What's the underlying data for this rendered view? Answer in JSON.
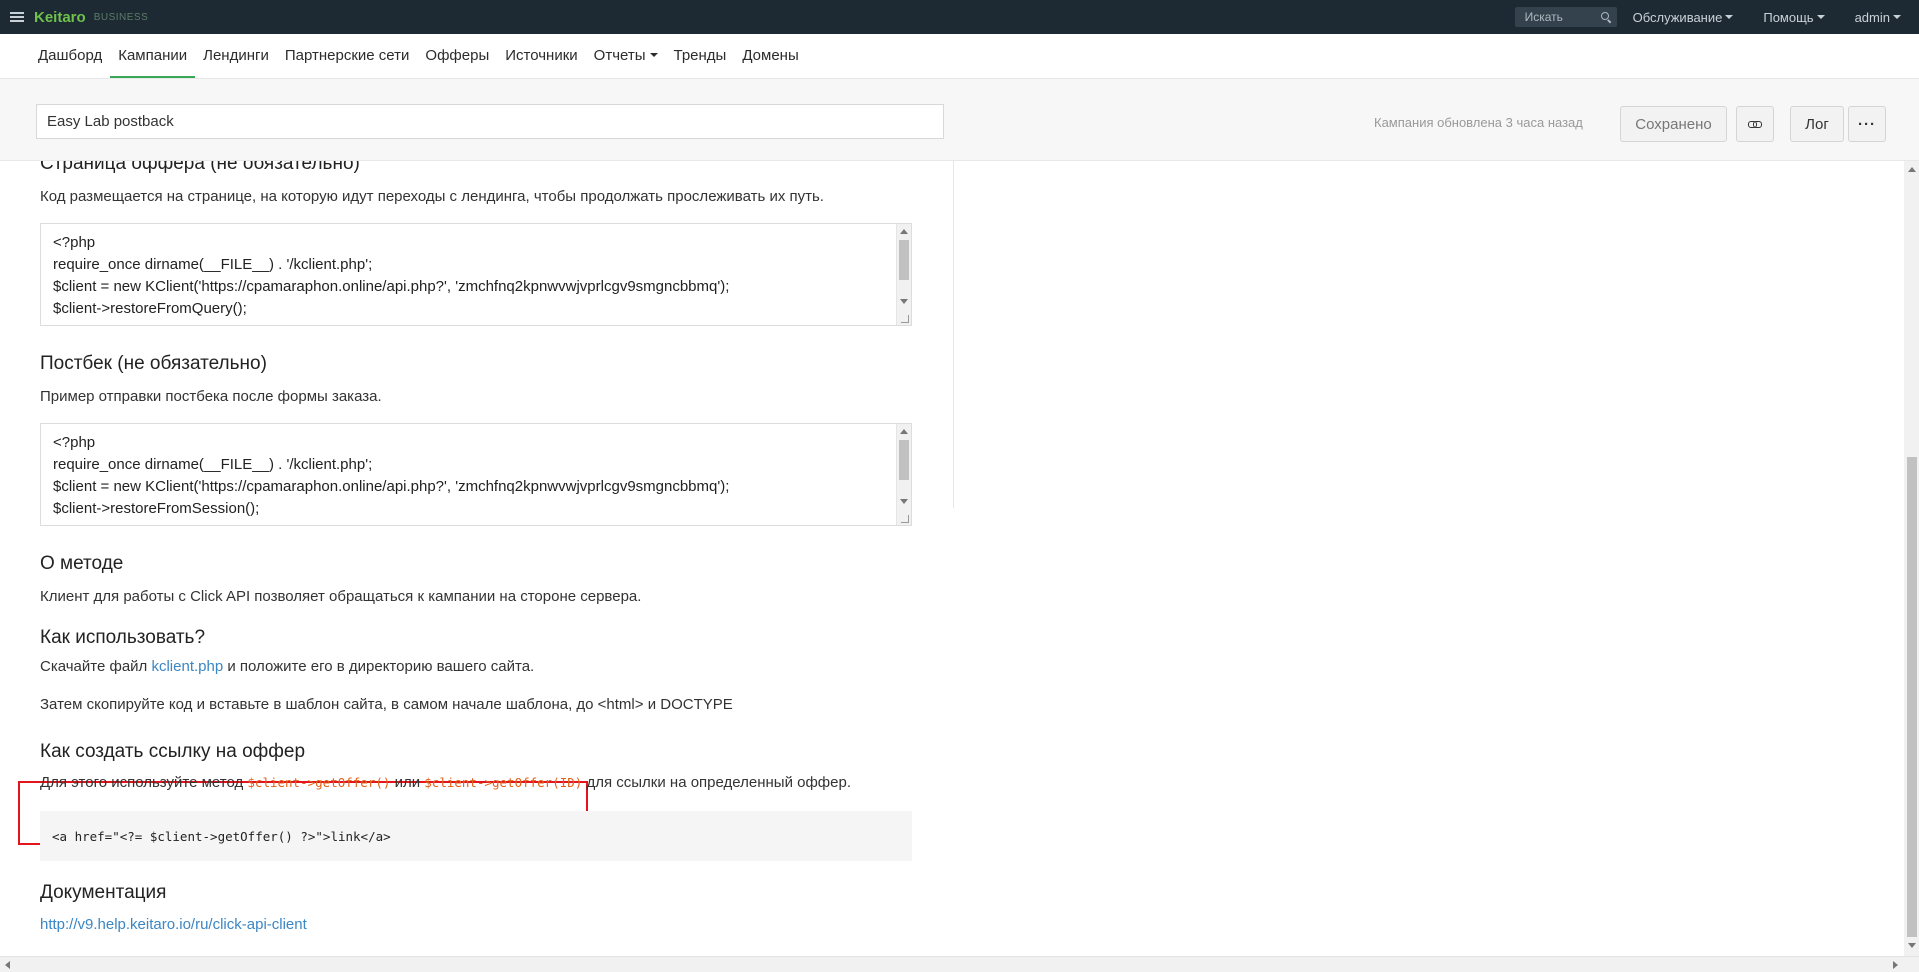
{
  "topbar": {
    "brand": "Keitaro",
    "edition": "BUSINESS",
    "search_placeholder": "Искать",
    "menus": [
      "Обслуживание",
      "Помощь",
      "admin"
    ]
  },
  "nav": {
    "items": [
      "Дашборд",
      "Кампании",
      "Лендинги",
      "Партнерские сети",
      "Офферы",
      "Источники",
      "Отчеты",
      "Тренды",
      "Домены"
    ],
    "active": "Кампании"
  },
  "campaign": {
    "name": "Easy Lab postback",
    "updated_text": "Кампания обновлена 3 часа назад",
    "saved_label": "Сохранено",
    "log_label": "Лог",
    "more_label": "···"
  },
  "sections": {
    "offer_page": {
      "title": "Страница оффера (не обязательно)",
      "text": "Код размещается на странице, на которую идут переходы с лендинга, чтобы продолжать прослеживать их путь.",
      "code": [
        "<?php",
        "require_once dirname(__FILE__) . '/kclient.php';",
        "$client = new KClient('https://cpamaraphon.online/api.php?', 'zmchfnq2kpnwvwjvprlcgv9smgncbbmq');",
        "$client->restoreFromQuery();",
        "?>"
      ]
    },
    "postback": {
      "title": "Постбек (не обязательно)",
      "text": "Пример отправки постбека после формы заказа.",
      "code": [
        "<?php",
        "require_once dirname(__FILE__) . '/kclient.php';",
        "$client = new KClient('https://cpamaraphon.online/api.php?', 'zmchfnq2kpnwvwjvprlcgv9smgncbbmq');",
        "$client->restoreFromSession();"
      ]
    },
    "about": {
      "title": "О методе",
      "text": "Клиент для работы с Click API позволяет обращаться к кампании на стороне сервера."
    },
    "howto": {
      "title": "Как использовать?",
      "text_before": "Скачайте файл ",
      "link": "kclient.php",
      "text_after": " и положите его в директорию вашего сайта.",
      "text2": "Затем скопируйте код и вставьте в шаблон сайта, в самом начале шаблона, до <html> и DOCTYPE"
    },
    "offer_link": {
      "title": "Как создать ссылку на оффер",
      "text_before": "Для этого используйте метод ",
      "code1": "$client->getOffer()",
      "text_mid": " или ",
      "code2": "$client->getOffer(ID)",
      "text_after": " для ссылки на определенный оффер.",
      "code_block": "<a href=\"<?= $client->getOffer() ?>\">link</a>"
    },
    "docs": {
      "title": "Документация",
      "link": "http://v9.help.keitaro.io/ru/click-api-client"
    }
  },
  "colors": {
    "topbar_bg": "#1d2a33",
    "brand": "#6ec14a",
    "active_tab": "#3aa757",
    "link": "#3b86c4",
    "code_inline": "#e0641c",
    "highlight": "#e3141b"
  }
}
